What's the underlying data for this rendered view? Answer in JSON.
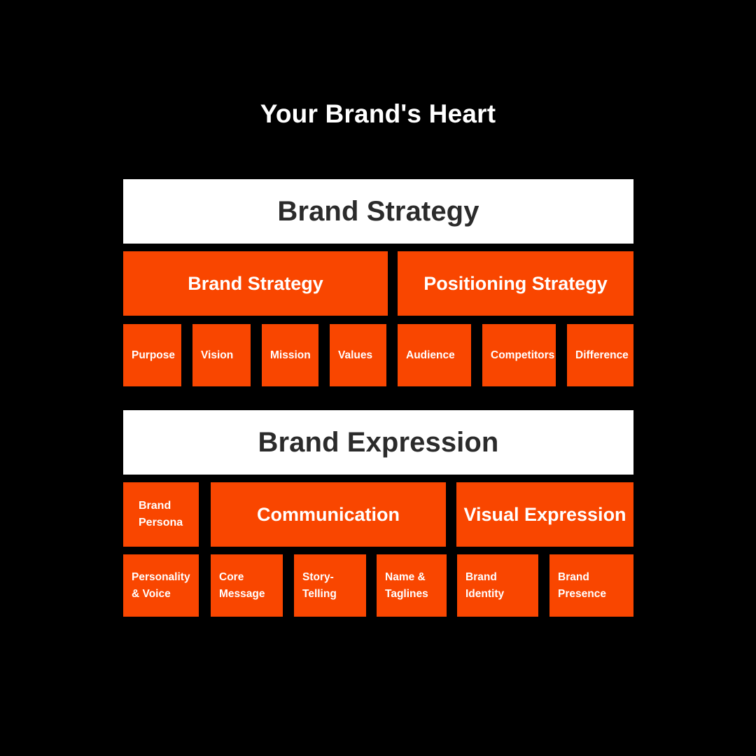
{
  "title": "Your Brand's Heart",
  "colors": {
    "background": "#000000",
    "accent_orange": "#f94600",
    "banner_background": "#ffffff",
    "banner_text": "#2b2b2b",
    "box_text": "#ffffff",
    "title_text": "#ffffff"
  },
  "sections": [
    {
      "banner": "Brand Strategy",
      "groups": [
        {
          "label": "Brand Strategy"
        },
        {
          "label": "Positioning Strategy"
        }
      ],
      "leaves": [
        {
          "label": "Purpose"
        },
        {
          "label": "Vision"
        },
        {
          "label": "Mission"
        },
        {
          "label": "Values"
        },
        {
          "label": "Audience"
        },
        {
          "label": "Competitors"
        },
        {
          "label": "Difference"
        }
      ]
    },
    {
      "banner": "Brand Expression",
      "groups": [
        {
          "label": "Brand Persona",
          "line1": "Brand",
          "line2": "Persona"
        },
        {
          "label": "Communication"
        },
        {
          "label": "Visual Expression"
        }
      ],
      "leaves": [
        {
          "line1": "Personality",
          "line2": "& Voice"
        },
        {
          "line1": "Core",
          "line2": "Message"
        },
        {
          "line1": "Story-",
          "line2": "Telling"
        },
        {
          "line1": "Name &",
          "line2": "Taglines"
        },
        {
          "line1": "Brand",
          "line2": "Identity"
        },
        {
          "line1": "Brand",
          "line2": "Presence"
        }
      ]
    }
  ]
}
